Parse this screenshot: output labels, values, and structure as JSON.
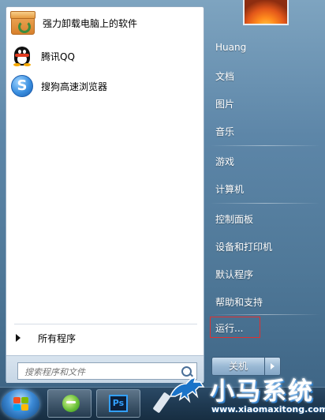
{
  "recent_programs": [
    {
      "label": "强力卸载电脑上的软件",
      "icon": "uninstall-box-icon"
    },
    {
      "label": "腾讯QQ",
      "icon": "qq-penguin-icon"
    },
    {
      "label": "搜狗高速浏览器",
      "icon": "sogou-browser-icon"
    }
  ],
  "all_programs": "所有程序",
  "search": {
    "placeholder": "搜索程序和文件",
    "icon": "search-icon"
  },
  "right_pane": {
    "user": "Huang",
    "documents": "文档",
    "pictures": "图片",
    "music": "音乐",
    "games": "游戏",
    "computer": "计算机",
    "control_panel": "控制面板",
    "devices_printers": "设备和打印机",
    "default_programs": "默认程序",
    "help_support": "帮助和支持",
    "run": "运行..."
  },
  "shutdown": {
    "label": "关机"
  },
  "taskbar": {
    "items": [
      "start-orb",
      "ie-browser-icon",
      "photoshop-icon",
      "pen-icon"
    ],
    "photoshop_text": "Ps"
  },
  "watermark": {
    "brand": "小马系统",
    "url": "www.xiaomaxitong.com"
  },
  "colors": {
    "highlight_red": "#e03030",
    "accent_blue": "#1a73c8"
  }
}
